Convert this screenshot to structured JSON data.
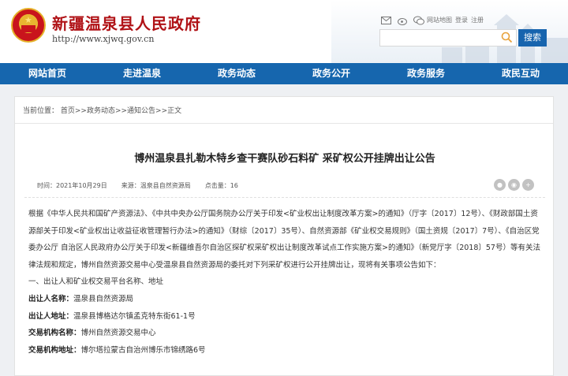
{
  "header": {
    "site_title": "新疆温泉县人民政府",
    "site_url": "http://www.xjwq.gov.cn",
    "top_links": [
      "网站地图",
      "登录",
      "注册"
    ],
    "search_placeholder": "",
    "search_button": "搜索"
  },
  "nav": {
    "items": [
      "网站首页",
      "走进温泉",
      "政务动态",
      "政务公开",
      "政务服务",
      "政民互动"
    ]
  },
  "breadcrumb": "当前位置： 首页>>政务动态>>通知公告>>正文",
  "article": {
    "title": "博州温泉县扎勒木特乡查干赛队砂石料矿 采矿权公开挂牌出让公告",
    "time": "时间：2021年10月29日",
    "source": "来源：温泉县自然资源局",
    "views": "点击量：16",
    "intro": "根据《中华人民共和国矿产资源法》、《中共中央办公厅国务院办公厅关于印发<矿业权出让制度改革方案>的通知》（厅字〔2017〕12号）、《财政部国土资源部关于印发<矿业权出让收益征收管理暂行办法>的通知》（财综〔2017〕35号）、自然资源部《矿业权交易规则》（国土资规〔2017〕7号）、《自治区党委办公厅 自治区人民政府办公厅关于印发<新疆维吾尔自治区探矿权采矿权出让制度改革试点工作实施方案>的通知》（新党厅字〔2018〕57号）等有关法律法规和规定，博州自然资源交易中心受温泉县自然资源局的委托对下列采矿权进行公开挂牌出让，现将有关事项公告如下：",
    "section1": "一、出让人和矿业权交易平台名称、地址",
    "fields": [
      {
        "label": "出让人名称：",
        "value": "温泉县自然资源局"
      },
      {
        "label": "出让人地址：",
        "value": "温泉县博格达尔镇孟克特东街61-1号"
      },
      {
        "label": "交易机构名称：",
        "value": "博州自然资源交易中心"
      },
      {
        "label": "交易机构地址：",
        "value": "博尔塔拉蒙古自治州博乐市锦绣路6号"
      }
    ]
  },
  "colors": {
    "nav_bg": "#1666ae",
    "title_red": "#b01216",
    "page_bg": "#eef0f3"
  }
}
